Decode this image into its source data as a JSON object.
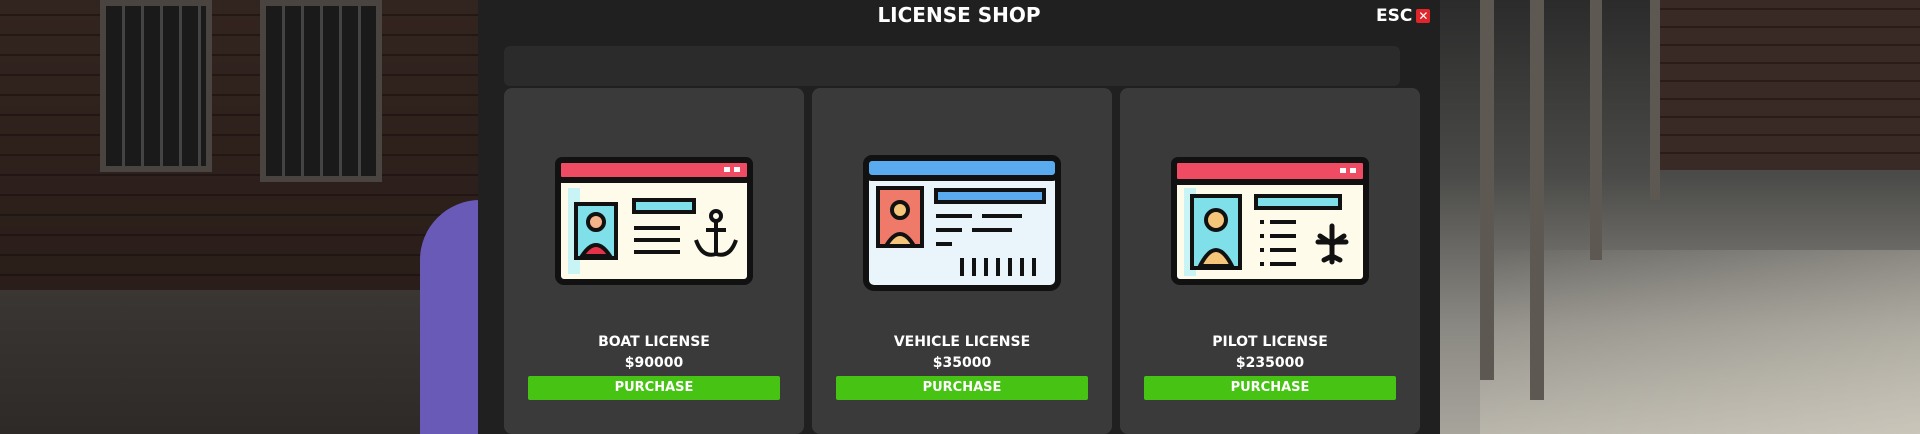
{
  "shop": {
    "title": "LICENSE SHOP",
    "close_label": "ESC",
    "close_icon": "close-icon"
  },
  "colors": {
    "panel": "#202020",
    "card": "#3a3a3a",
    "purchase_button": "#47c313",
    "close_icon": "#e0252b"
  },
  "cards": [
    {
      "name": "BOAT LICENSE",
      "price": "$90000",
      "button": "PURCHASE",
      "icon": "boat-license-card-icon"
    },
    {
      "name": "VEHICLE LICENSE",
      "price": "$35000",
      "button": "PURCHASE",
      "icon": "vehicle-license-card-icon"
    },
    {
      "name": "PILOT LICENSE",
      "price": "$235000",
      "button": "PURCHASE",
      "icon": "pilot-license-card-icon"
    }
  ]
}
